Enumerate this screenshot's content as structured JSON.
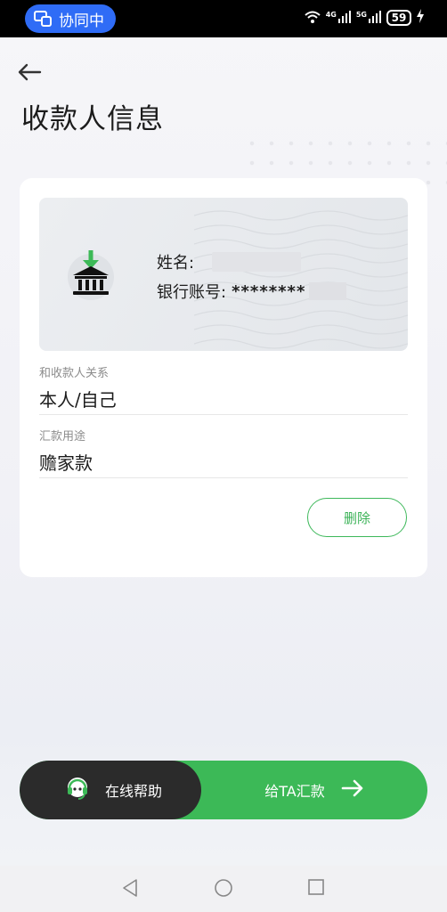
{
  "status_bar": {
    "collab_label": "协同中",
    "network_1": "4G",
    "network_2": "5G",
    "battery": "59"
  },
  "page": {
    "title": "收款人信息"
  },
  "payee_card": {
    "name_label": "姓名:",
    "account_label": "银行账号:",
    "account_masked": "********",
    "relationship_label": "和收款人关系",
    "relationship_value": "本人/自己",
    "purpose_label": "汇款用途",
    "purpose_value": "赡家款",
    "delete_label": "删除"
  },
  "bottom_bar": {
    "help_label": "在线帮助",
    "transfer_label": "给TA汇款"
  },
  "colors": {
    "accent_green": "#3cb957",
    "collab_blue": "#2f6cf6",
    "dark": "#2b2b2b"
  }
}
